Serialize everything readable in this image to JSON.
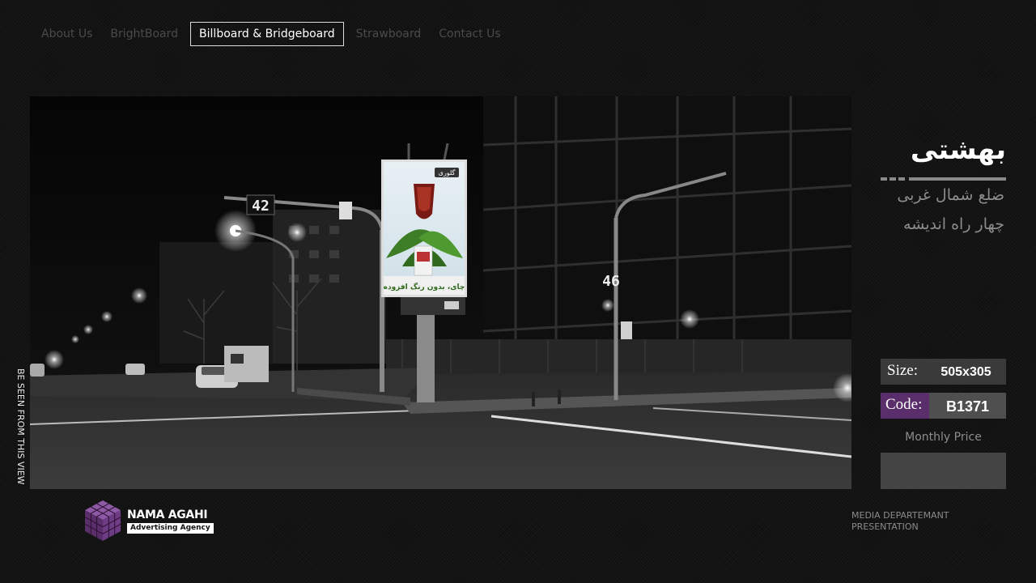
{
  "nav": {
    "items": [
      {
        "label": "About Us"
      },
      {
        "label": "BrightBoard"
      },
      {
        "label": "Billboard & Bridgeboard",
        "active": true
      },
      {
        "label": "Strawboard"
      },
      {
        "label": "Contact Us"
      }
    ]
  },
  "photo": {
    "vertical_caption": "BE SEEN FROM THIS VIEW",
    "signal_left": "42",
    "signal_right": "46",
    "billboard_brand": "گلوری",
    "billboard_slogan": "چای، بدون رنگ افزوده"
  },
  "location": {
    "title": "بهشتی",
    "line1": "ضلع شمال غربی",
    "line2": "چهار راه اندیشه"
  },
  "specs": {
    "size_label": "Size:",
    "size_value": "505x305",
    "code_label": "Code:",
    "code_value": "B1371",
    "price_label": "Monthly Price",
    "price_value": ""
  },
  "footer": {
    "logo_name": "NAMA AGAHI",
    "logo_tag": "Advertising Agency",
    "caption_line1": "MEDIA DEPARTEMANT",
    "caption_line2": "PRESENTATION"
  },
  "colors": {
    "background": "#101010",
    "accent_purple": "#5a2e6a",
    "panel_gray": "#3a3a3a"
  }
}
